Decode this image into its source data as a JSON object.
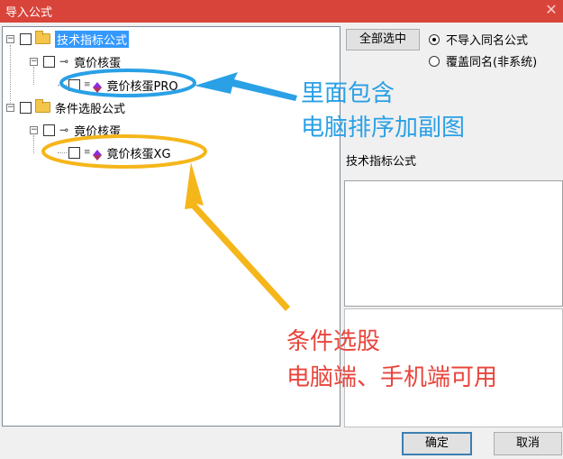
{
  "window": {
    "title": "导入公式",
    "close_glyph": "✕"
  },
  "tree": {
    "nodes": [
      {
        "label": "技术指标公式",
        "selected": true
      },
      {
        "label": "竟价核蛋"
      },
      {
        "label": "竟价核蛋PRO"
      },
      {
        "label": "条件选股公式"
      },
      {
        "label": "竟价核蛋"
      },
      {
        "label": "竟价核蛋XG"
      }
    ]
  },
  "side": {
    "select_all_label": "全部选中",
    "options": [
      {
        "label": "不导入同名公式",
        "checked": true
      },
      {
        "label": "覆盖同名(非系统)",
        "checked": false
      }
    ],
    "formula_group": "技术指标公式"
  },
  "footer": {
    "ok_label": "确定",
    "cancel_label": "取消"
  },
  "annotations": {
    "blue_line1": "里面包含",
    "blue_line2": "电脑排序加副图",
    "red_line1": "条件选股",
    "red_line2": "电脑端、手机端可用"
  },
  "colors": {
    "titlebar": "#d9443a",
    "blue_annotation": "#2aa0e6",
    "yellow_annotation": "#f5b61a",
    "red_annotation": "#e8453c",
    "selection": "#3399ff"
  }
}
